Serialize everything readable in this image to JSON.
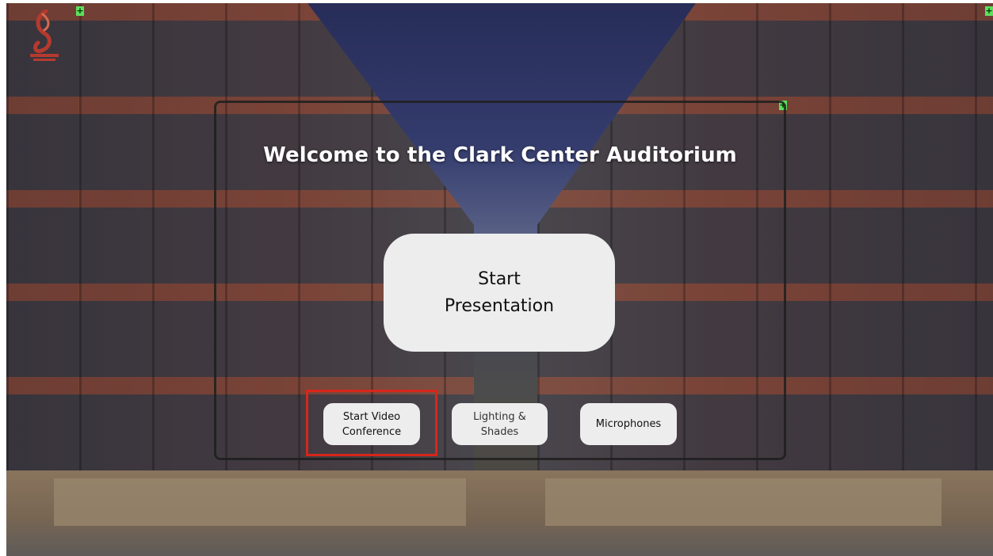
{
  "header": {
    "title": "Welcome to the Clark Center Auditorium"
  },
  "buttons": {
    "start_presentation": "Start\nPresentation",
    "start_video_conference": "Start Video\nConference",
    "lighting_shades": "Lighting &\nShades",
    "microphones": "Microphones"
  },
  "highlight": {
    "target": "start_video_conference",
    "color": "#d7261a"
  },
  "markers": {
    "plus_label": "+",
    "color": "#5ee05e"
  },
  "colors": {
    "button_bg": "#ededed",
    "title_text": "#ffffff"
  }
}
